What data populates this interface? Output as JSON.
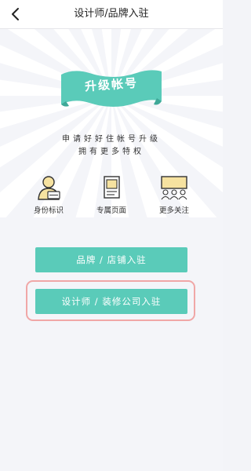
{
  "header": {
    "title": "设计师/品牌入驻"
  },
  "banner": {
    "title": "升级帐号",
    "subtitle_line1": "申请好好住帐号升级",
    "subtitle_line2": "拥有更多特权"
  },
  "features": [
    {
      "label": "身份标识",
      "icon": "id-badge-icon"
    },
    {
      "label": "专属页面",
      "icon": "page-icon"
    },
    {
      "label": "更多关注",
      "icon": "audience-icon"
    }
  ],
  "buttons": {
    "brand": "品牌 / 店铺入驻",
    "designer": "设计师 / 装修公司入驻"
  },
  "colors": {
    "accent": "#5acbb9",
    "highlight": "#f0a7a7",
    "icon_fill": "#f6e2a0"
  }
}
